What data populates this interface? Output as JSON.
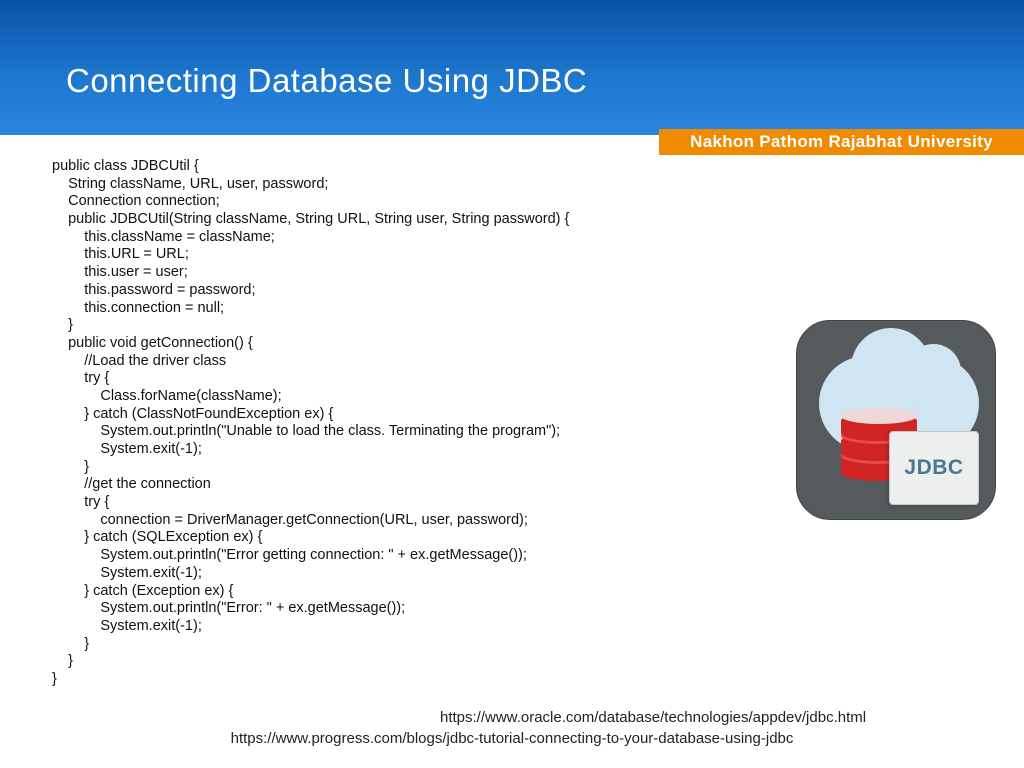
{
  "header": {
    "title": "Connecting Database Using JDBC"
  },
  "ribbon": {
    "label": "Nakhon Pathom Rajabhat University"
  },
  "code": "public class JDBCUtil {\n    String className, URL, user, password;\n    Connection connection;\n    public JDBCUtil(String className, String URL, String user, String password) {\n        this.className = className;\n        this.URL = URL;\n        this.user = user;\n        this.password = password;\n        this.connection = null;\n    }\n    public void getConnection() {\n        //Load the driver class\n        try {\n            Class.forName(className);\n        } catch (ClassNotFoundException ex) {\n            System.out.println(\"Unable to load the class. Terminating the program\");\n            System.exit(-1);\n        }\n        //get the connection\n        try {\n            connection = DriverManager.getConnection(URL, user, password);\n        } catch (SQLException ex) {\n            System.out.println(\"Error getting connection: \" + ex.getMessage());\n            System.exit(-1);\n        } catch (Exception ex) {\n            System.out.println(\"Error: \" + ex.getMessage());\n            System.exit(-1);\n        }\n    }\n}",
  "footer": {
    "link1": "https://www.oracle.com/database/technologies/appdev/jdbc.html",
    "link2": "https://www.progress.com/blogs/jdbc-tutorial-connecting-to-your-database-using-jdbc"
  },
  "icon": {
    "card_label": "JDBC"
  }
}
